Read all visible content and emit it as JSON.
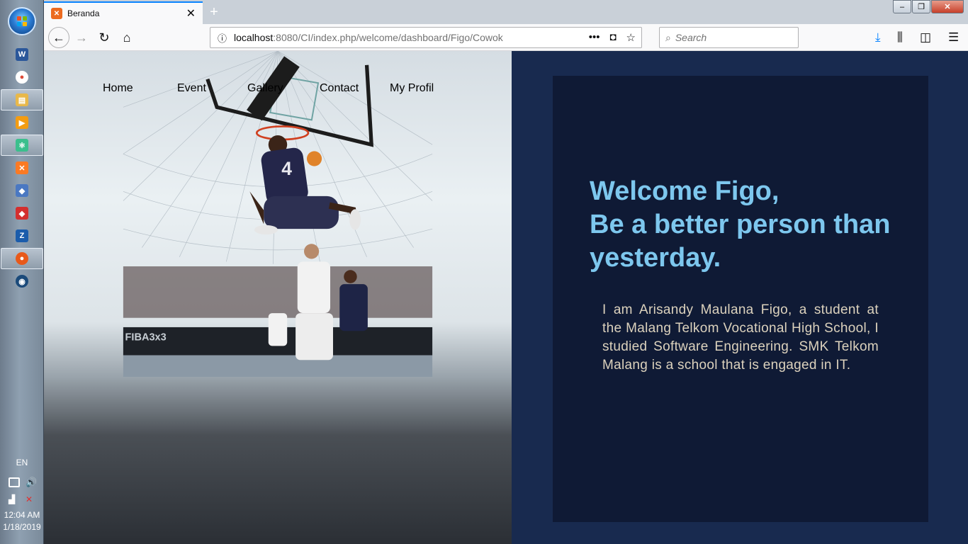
{
  "taskbar": {
    "apps": [
      {
        "name": "word",
        "glyph": "W",
        "color": "#2b579a"
      },
      {
        "name": "chrome",
        "glyph": "●",
        "color": "#dd4b39"
      },
      {
        "name": "file-explorer",
        "glyph": "▤",
        "color": "#e8b84a"
      },
      {
        "name": "media-player",
        "glyph": "▶",
        "color": "#f39c12"
      },
      {
        "name": "atom",
        "glyph": "⚛",
        "color": "#3bbf8d"
      },
      {
        "name": "xampp",
        "glyph": "✕",
        "color": "#fb7a24"
      },
      {
        "name": "virtualbox",
        "glyph": "◆",
        "color": "#4a78c2"
      },
      {
        "name": "git-app",
        "glyph": "◆",
        "color": "#d32f2f"
      },
      {
        "name": "filezilla",
        "glyph": "Z",
        "color": "#1b5cab"
      },
      {
        "name": "firefox",
        "glyph": "●",
        "color": "#e8591a"
      },
      {
        "name": "steam",
        "glyph": "◉",
        "color": "#1b4a7a"
      }
    ],
    "language": "EN",
    "time": "12:04 AM",
    "date": "1/18/2019"
  },
  "browser": {
    "tab_title": "Beranda",
    "url_host": "localhost",
    "url_path": ":8080/CI/index.php/welcome/dashboard/Figo/Cowok",
    "search_placeholder": "Search"
  },
  "nav": {
    "items": [
      "Home",
      "Event",
      "Gallery",
      "Contact",
      "My Profil"
    ]
  },
  "hero": {
    "jersey_number": "4",
    "banner_text": "FIBA3x3"
  },
  "content": {
    "welcome_line1": "Welcome Figo,",
    "welcome_line2": "Be a better person than yesterday.",
    "intro": "I am Arisandy Maulana Figo, a student at the Malang Telkom Vocational High School, I studied Software Engineering. SMK Telkom Malang is a school that is engaged in IT."
  },
  "colors": {
    "panel_bg": "#182a4f",
    "card_bg": "#0f1a35",
    "heading": "#7dc7ee",
    "body_text": "#dcd2bd"
  }
}
